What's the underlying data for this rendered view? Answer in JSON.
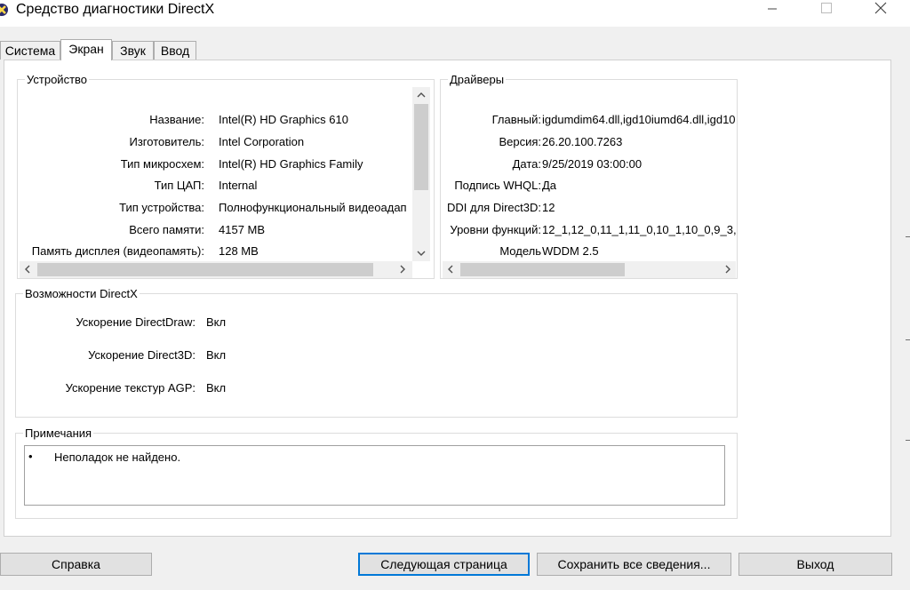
{
  "window": {
    "title": "Средство диагностики DirectX"
  },
  "tabs": [
    {
      "label": "Система",
      "active": false
    },
    {
      "label": "Экран",
      "active": true
    },
    {
      "label": "Звук",
      "active": false
    },
    {
      "label": "Ввод",
      "active": false
    }
  ],
  "device": {
    "title": "Устройство",
    "rows": [
      {
        "label": "Название:",
        "value": "Intel(R) HD Graphics 610"
      },
      {
        "label": "Изготовитель:",
        "value": "Intel Corporation"
      },
      {
        "label": "Тип микросхем:",
        "value": "Intel(R) HD Graphics Family"
      },
      {
        "label": "Тип ЦАП:",
        "value": "Internal"
      },
      {
        "label": "Тип устройства:",
        "value": "Полнофункциональный видеоадап"
      },
      {
        "label": "Всего памяти:",
        "value": "4157 MB"
      },
      {
        "label": "Память дисплея (видеопамять):",
        "value": "128 MB"
      }
    ]
  },
  "drivers": {
    "title": "Драйверы",
    "rows": [
      {
        "label": "Главный:",
        "value": "igdumdim64.dll,igd10iumd64.dll,igd10"
      },
      {
        "label": "Версия:",
        "value": "26.20.100.7263"
      },
      {
        "label": "Дата:",
        "value": "9/25/2019 03:00:00"
      },
      {
        "label": "Подпись WHQL:",
        "value": "Да"
      },
      {
        "label": "DDI для Direct3D:",
        "value": "12"
      },
      {
        "label": "Уровни функций:",
        "value": "12_1,12_0,11_1,11_0,10_1,10_0,9_3,"
      },
      {
        "label": "Модель",
        "value": "WDDM 2.5"
      }
    ]
  },
  "directx": {
    "title": "Возможности DirectX",
    "rows": [
      {
        "label": "Ускорение DirectDraw:",
        "value": "Вкл"
      },
      {
        "label": "Ускорение Direct3D:",
        "value": "Вкл"
      },
      {
        "label": "Ускорение текстур AGP:",
        "value": "Вкл"
      }
    ]
  },
  "notes": {
    "title": "Примечания",
    "items": [
      "Неполадок не найдено."
    ]
  },
  "buttons": {
    "help": "Справка",
    "next": "Следующая страница",
    "save": "Сохранить все сведения...",
    "exit": "Выход"
  },
  "colors": {
    "background": "#f0f0f0",
    "panel": "#ffffff",
    "focus_border": "#0078d7",
    "scroll_thumb": "#cdcdcd"
  },
  "icons": [
    "directx-app-icon",
    "minimize-icon",
    "maximize-icon",
    "close-icon",
    "chevron-up-icon",
    "chevron-down-icon",
    "chevron-left-icon",
    "chevron-right-icon",
    "bullet-icon"
  ]
}
